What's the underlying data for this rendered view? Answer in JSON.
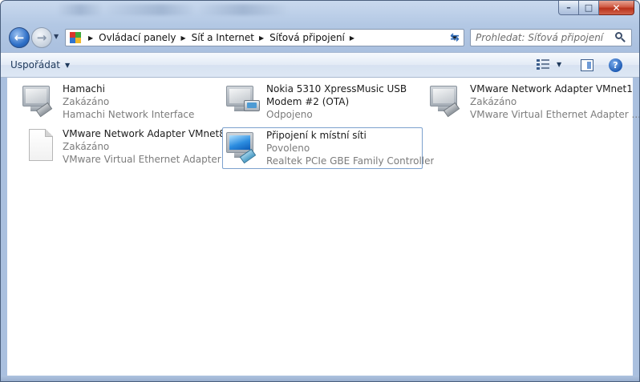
{
  "window": {
    "caption_buttons": {
      "minimize": "–",
      "maximize": "□",
      "close": "✕"
    }
  },
  "nav": {
    "back_icon": "arrow-left-icon",
    "forward_icon": "arrow-right-icon",
    "breadcrumbs": [
      "Ovládací panely",
      "Síť a Internet",
      "Síťová připojení"
    ],
    "search_placeholder": "Prohledat: Síťová připojení"
  },
  "toolbar": {
    "organize_label": "Uspořádat"
  },
  "connections": [
    {
      "name": "Hamachi",
      "status": "Zakázáno",
      "device": "Hamachi Network Interface",
      "icon": "network-adapter-disabled-icon"
    },
    {
      "name": "Nokia 5310 XpressMusic USB",
      "name2": "Modem #2 (OTA)",
      "status": "Odpojeno",
      "device": "",
      "icon": "phone-modem-icon"
    },
    {
      "name": "VMware Network Adapter VMnet1",
      "status": "Zakázáno",
      "device": "VMware Virtual Ethernet Adapter ...",
      "icon": "network-adapter-disabled-icon"
    },
    {
      "name": "VMware Network Adapter VMnet8",
      "status": "Zakázáno",
      "device": "VMware Virtual Ethernet Adapter ...",
      "icon": "blank-document-icon"
    },
    {
      "name": "Připojení k místní síti",
      "status": "Povoleno",
      "device": "Realtek PCIe GBE Family Controller",
      "icon": "network-adapter-enabled-icon",
      "selected": true
    }
  ]
}
